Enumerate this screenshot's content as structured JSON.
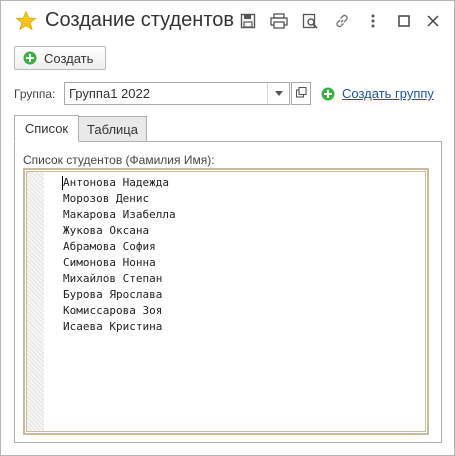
{
  "window": {
    "title": "Создание студентов",
    "icons": [
      "star-icon",
      "save-icon",
      "print-icon",
      "preview-icon",
      "link-icon",
      "more-icon",
      "maximize-icon",
      "close-icon"
    ]
  },
  "toolbar": {
    "create_label": "Создать"
  },
  "group": {
    "label": "Группа:",
    "value": "Группа1 2022",
    "create_link": "Создать группу"
  },
  "tabs": [
    {
      "label": "Список",
      "active": true
    },
    {
      "label": "Таблица",
      "active": false
    }
  ],
  "students": {
    "label": "Список студентов (Фамилия Имя):",
    "lines": [
      "Антонова Надежда",
      "Морозов Денис",
      "Макарова Изабелла",
      "Жукова Оксана",
      "Абрамова София",
      "Симонова Нонна",
      "Михайлов Степан",
      "Бурова Ярослава",
      "Комиссарова Зоя",
      "Исаева Кристина"
    ]
  },
  "colors": {
    "star": "#f5c518",
    "plus": "#3cb043",
    "link": "#1a55a8",
    "textbox_border": "#cbb99b"
  }
}
